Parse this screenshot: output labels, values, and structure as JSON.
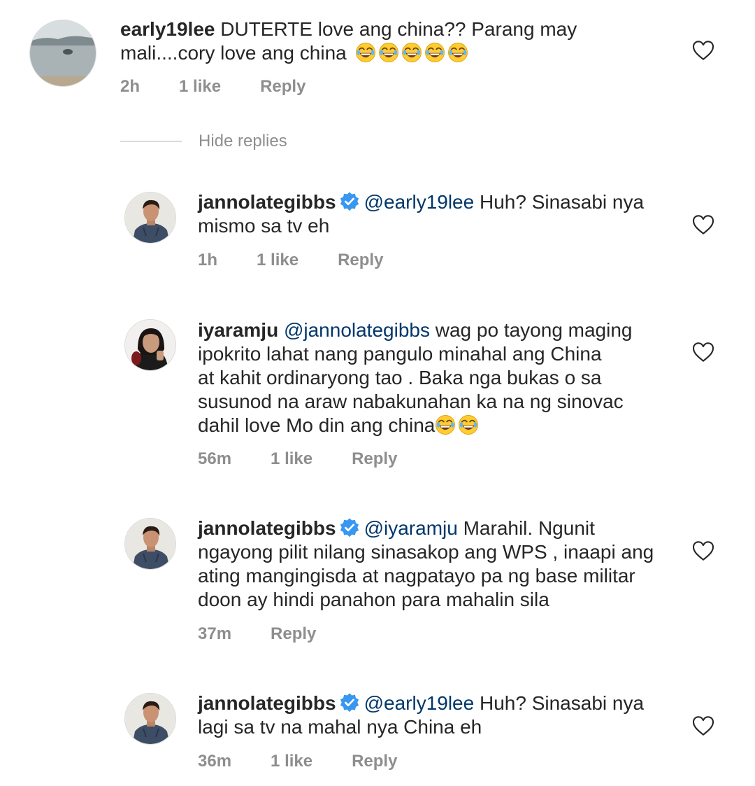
{
  "hide_replies_label": "Hide replies",
  "comments": [
    {
      "username": "early19lee",
      "verified": false,
      "mention": "",
      "text_lines": [
        "DUTERTE love ang china?? Parang may",
        "mali....cory love ang china"
      ],
      "emoji_count": 5,
      "time": "2h",
      "likes": "1 like",
      "reply_label": "Reply",
      "avatar_icon": "beach-photo"
    },
    {
      "username": "jannolategibbs",
      "verified": true,
      "mention": "@early19lee",
      "text_lines": [
        " Huh? Sinasabi nya",
        "mismo sa tv eh"
      ],
      "emoji_count": 0,
      "time": "1h",
      "likes": "1 like",
      "reply_label": "Reply",
      "avatar_icon": "man-hoodie-photo"
    },
    {
      "username": "iyaramju",
      "verified": false,
      "mention": "@jannolategibbs",
      "text_lines": [
        " wag po tayong maging",
        "ipokrito lahat nang pangulo minahal ang China",
        "at kahit ordinaryong tao . Baka nga bukas o sa",
        "susunod na araw nabakunahan ka na ng sinovac",
        "dahil love Mo din ang china"
      ],
      "emoji_count": 2,
      "time": "56m",
      "likes": "1 like",
      "reply_label": "Reply",
      "avatar_icon": "woman-photo"
    },
    {
      "username": "jannolategibbs",
      "verified": true,
      "mention": "@iyaramju",
      "text_lines": [
        " Marahil. Ngunit",
        "ngayong pilit nilang sinasakop ang WPS , inaapi ang",
        "ating mangingisda at nagpatayo pa ng base militar",
        "doon ay hindi panahon para mahalin sila"
      ],
      "emoji_count": 0,
      "time": "37m",
      "likes": "",
      "reply_label": "Reply",
      "avatar_icon": "man-hoodie-photo"
    },
    {
      "username": "jannolategibbs",
      "verified": true,
      "mention": "@early19lee",
      "text_lines": [
        " Huh? Sinasabi nya",
        "lagi sa tv na mahal nya China eh"
      ],
      "emoji_count": 0,
      "time": "36m",
      "likes": "1 like",
      "reply_label": "Reply",
      "avatar_icon": "man-hoodie-photo"
    }
  ],
  "colors": {
    "text": "#262626",
    "muted": "#8e8e8e",
    "mention": "#00376b",
    "verified": "#3897f0",
    "divider": "#dbdbdb"
  }
}
